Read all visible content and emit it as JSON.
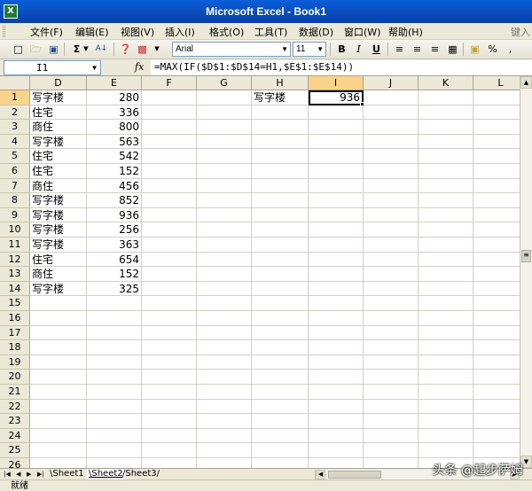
{
  "window": {
    "title": "Microsoft Excel - Book1",
    "app_icon": "X"
  },
  "menu": {
    "items": [
      "文件(F)",
      "编辑(E)",
      "视图(V)",
      "插入(I)",
      "格式(O)",
      "工具(T)",
      "数据(D)",
      "窗口(W)",
      "帮助(H)"
    ],
    "search_placeholder": "键入"
  },
  "toolbar": {
    "font_name": "Arial",
    "font_size": "11",
    "sum_symbol": "Σ",
    "sort_symbol": "A↓",
    "bold": "B",
    "italic": "I",
    "underline": "U",
    "percent": "%",
    "comma": ","
  },
  "formula_bar": {
    "name_box": "I1",
    "fx": "fx",
    "formula": "=MAX(IF($D$1:$D$14=H1,$E$1:$E$14))"
  },
  "grid": {
    "columns": [
      "D",
      "E",
      "F",
      "G",
      "H",
      "I",
      "J",
      "K",
      "L"
    ],
    "active_column": "I",
    "active_row": 1,
    "rows": [
      1,
      2,
      3,
      4,
      5,
      6,
      7,
      8,
      9,
      10,
      11,
      12,
      13,
      14,
      15,
      16,
      17,
      18,
      19,
      20,
      21,
      22,
      23,
      24,
      25,
      26
    ],
    "col_d": [
      "写字楼",
      "住宅",
      "商住",
      "写字楼",
      "住宅",
      "住宅",
      "商住",
      "写字楼",
      "写字楼",
      "写字楼",
      "写字楼",
      "住宅",
      "商住",
      "写字楼"
    ],
    "col_e": [
      280,
      336,
      800,
      563,
      542,
      152,
      456,
      852,
      936,
      256,
      363,
      654,
      152,
      325
    ],
    "h1": "写字楼",
    "i1": "936"
  },
  "sheets": {
    "tabs": [
      "Sheet1",
      "Sheet2",
      "Sheet3"
    ],
    "active": "Sheet2"
  },
  "status": {
    "text": "就绪"
  },
  "watermark": "头条 @起步萨姆"
}
